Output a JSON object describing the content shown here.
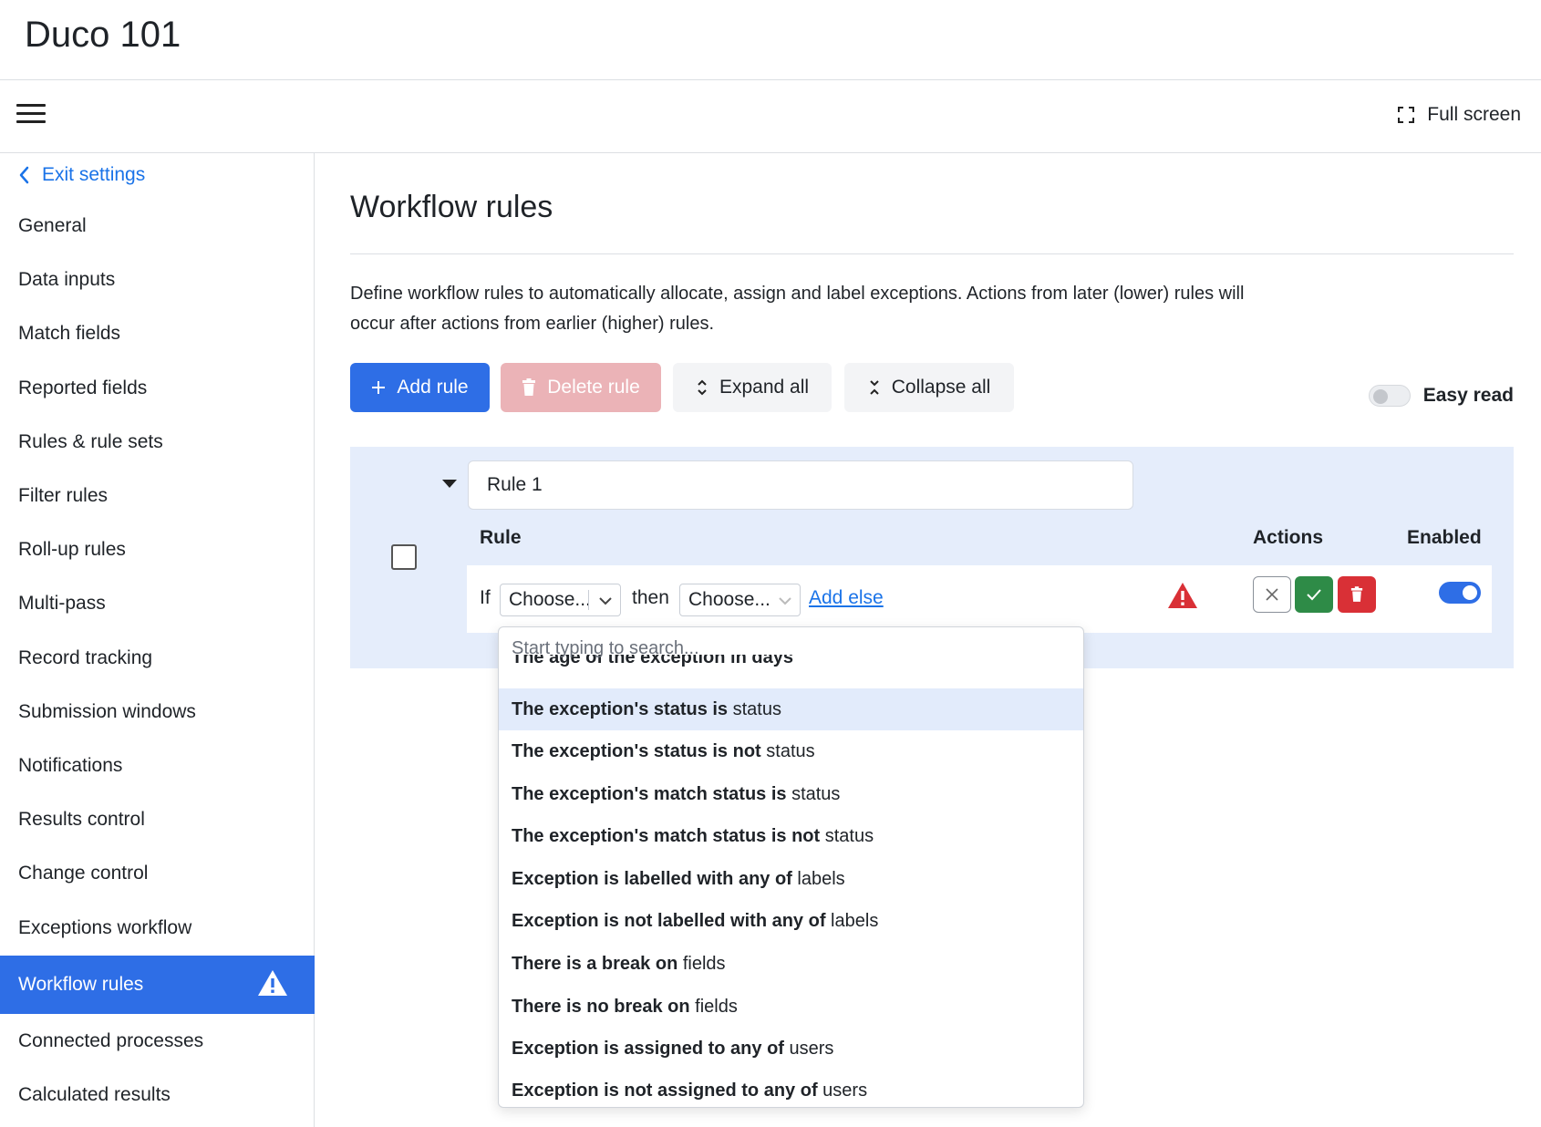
{
  "app": {
    "title": "Duco 101"
  },
  "toolbar": {
    "fullscreen_label": "Full screen"
  },
  "sidebar": {
    "exit_label": "Exit settings",
    "items": [
      {
        "label": "General"
      },
      {
        "label": "Data inputs"
      },
      {
        "label": "Match fields"
      },
      {
        "label": "Reported fields"
      },
      {
        "label": "Rules & rule sets"
      },
      {
        "label": "Filter rules"
      },
      {
        "label": "Roll-up rules"
      },
      {
        "label": "Multi-pass"
      },
      {
        "label": "Record tracking"
      },
      {
        "label": "Submission windows"
      },
      {
        "label": "Notifications"
      },
      {
        "label": "Results control"
      },
      {
        "label": "Change control"
      },
      {
        "label": "Exceptions workflow"
      },
      {
        "label": "Workflow rules",
        "active": true,
        "warning": true
      },
      {
        "label": "Connected processes"
      },
      {
        "label": "Calculated results"
      }
    ]
  },
  "main": {
    "title": "Workflow rules",
    "description": "Define workflow rules to automatically allocate, assign and label exceptions. Actions from later (lower) rules will occur after actions from earlier (higher) rules.",
    "buttons": {
      "add": "Add rule",
      "delete": "Delete rule",
      "expand": "Expand all",
      "collapse": "Collapse all"
    },
    "easy_read_label": "Easy read"
  },
  "rule": {
    "name": "Rule 1",
    "columns": {
      "rule": "Rule",
      "actions": "Actions",
      "enabled": "Enabled"
    },
    "if_label": "If",
    "if_value": "Choose...",
    "then_label": "then",
    "then_value": "Choose...",
    "add_else": "Add else",
    "enabled": true
  },
  "dropdown": {
    "placeholder": "Start typing to search...",
    "clipped_item": {
      "bold": "The age of the exception in days",
      "rest": ""
    },
    "items": [
      {
        "bold": "The exception's status is",
        "rest": " status",
        "highlighted": true
      },
      {
        "bold": "The exception's status is not",
        "rest": " status"
      },
      {
        "bold": "The exception's match status is",
        "rest": " status"
      },
      {
        "bold": "The exception's match status is not",
        "rest": " status"
      },
      {
        "bold": "Exception is labelled with any of",
        "rest": " labels"
      },
      {
        "bold": "Exception is not labelled with any of",
        "rest": " labels"
      },
      {
        "bold": "There is a break on",
        "rest": " fields"
      },
      {
        "bold": "There is no break on",
        "rest": " fields"
      },
      {
        "bold": "Exception is assigned to any of",
        "rest": " users"
      },
      {
        "bold": "Exception is not assigned to any of",
        "rest": " users"
      }
    ]
  },
  "colors": {
    "accent": "#2e6ee6",
    "link": "#1a73e8",
    "danger": "#d93036",
    "success": "#2e8b47",
    "panel": "#e5edfb"
  },
  "icons": {
    "menu": "hamburger-icon",
    "fullscreen": "fullscreen-icon",
    "back": "chevron-left-icon",
    "warning": "warning-icon",
    "add": "plus-icon",
    "delete": "trash-icon",
    "expand": "expand-icon",
    "collapse": "collapse-icon"
  }
}
